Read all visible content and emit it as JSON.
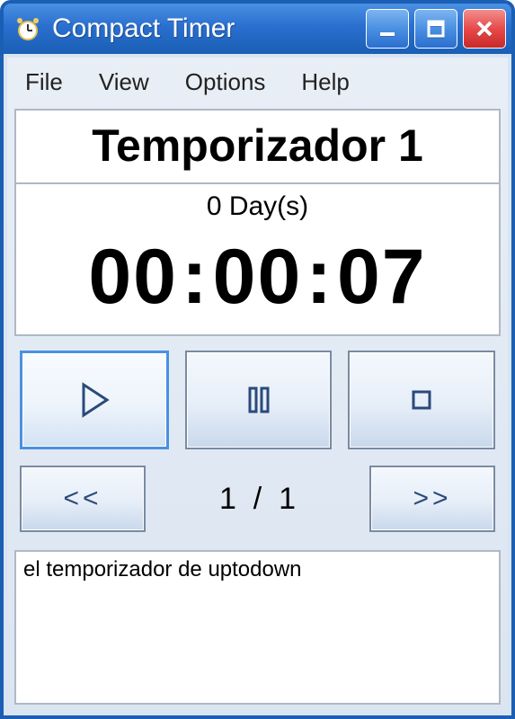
{
  "window": {
    "title": "Compact Timer"
  },
  "menubar": {
    "file": "File",
    "view": "View",
    "options": "Options",
    "help": "Help"
  },
  "timer": {
    "name": "Temporizador 1",
    "days_label": "0 Day(s)",
    "hh": "00",
    "mm": "00",
    "ss": "07"
  },
  "nav": {
    "current": "1",
    "sep": "/",
    "total": "1",
    "prev": "<<",
    "next": ">>"
  },
  "footer": {
    "text": "el temporizador de uptodown"
  }
}
